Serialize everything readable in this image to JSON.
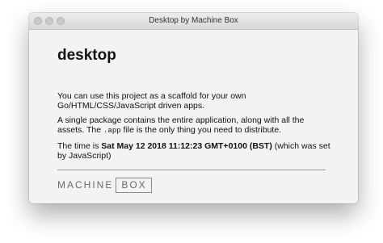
{
  "window": {
    "title": "Desktop by Machine Box"
  },
  "page": {
    "heading": "desktop",
    "paragraph1": "You can use this project as a scaffold for your own Go/HTML/CSS/JavaScript driven apps.",
    "paragraph2_before": "A single package contains the entire application, along with all the assets. The ",
    "paragraph2_code": ".app",
    "paragraph2_after": " file is the only thing you need to distribute.",
    "paragraph3_before": "The time is ",
    "paragraph3_time": "Sat May 12 2018 11:12:23 GMT+0100 (BST)",
    "paragraph3_after": " (which was set by JavaScript)"
  },
  "logo": {
    "machine": "MACHINE",
    "box": "BOX"
  },
  "icons": {
    "close": "traffic-light-close",
    "minimize": "traffic-light-minimize",
    "maximize": "traffic-light-maximize"
  },
  "colors": {
    "traffic_inactive": "#c9c9c9",
    "content_bg": "#f3f3f3"
  }
}
